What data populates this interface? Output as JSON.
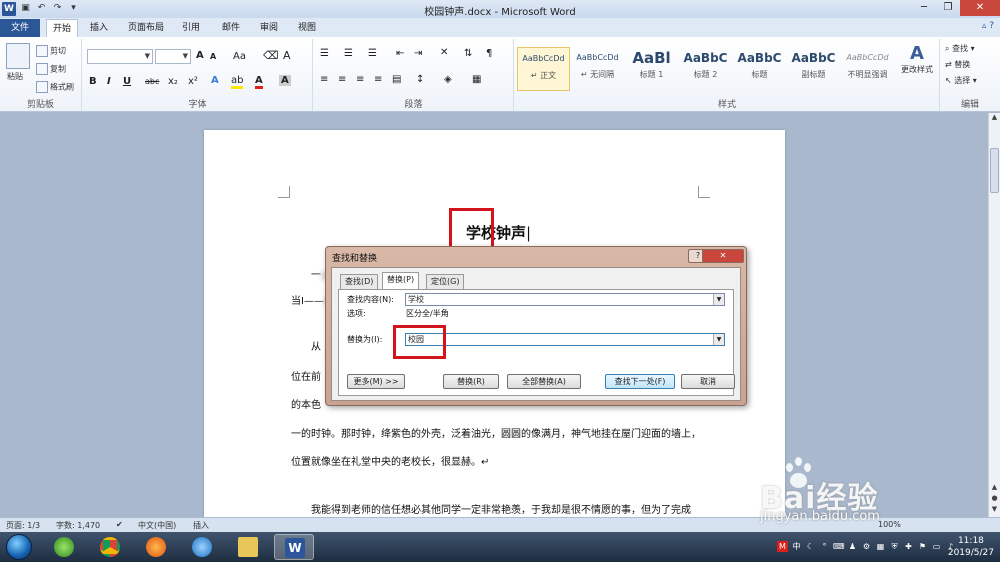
{
  "window": {
    "title": "校园钟声.docx - Microsoft Word",
    "app_icon": "W",
    "min": "─",
    "max": "❐",
    "close": "✕"
  },
  "tabs": {
    "file": "文件",
    "items": [
      "开始",
      "插入",
      "页面布局",
      "引用",
      "邮件",
      "审阅",
      "视图"
    ],
    "active": "开始"
  },
  "ribbon": {
    "clipboard": {
      "label": "剪贴板",
      "paste": "粘贴",
      "cut": "剪切",
      "copy": "复制",
      "format_painter": "格式刷"
    },
    "font": {
      "label": "字体",
      "bold": "B",
      "italic": "I",
      "underline": "U",
      "strike": "abc",
      "sub": "x₂",
      "sup": "x²",
      "grow": "A",
      "shrink": "A",
      "case": "Aa"
    },
    "paragraph": {
      "label": "段落"
    },
    "styles": {
      "label": "样式",
      "items": [
        {
          "preview": "AaBbCcDd",
          "name": "↵ 正文"
        },
        {
          "preview": "AaBbCcDd",
          "name": "↵ 无间隔"
        },
        {
          "preview": "AaBl",
          "name": "标题 1"
        },
        {
          "preview": "AaBbC",
          "name": "标题 2"
        },
        {
          "preview": "AaBbC",
          "name": "标题"
        },
        {
          "preview": "AaBbC",
          "name": "副标题"
        },
        {
          "preview": "AaBbCcDd",
          "name": "不明显强调"
        }
      ],
      "change": "更改样式"
    },
    "editing": {
      "label": "编辑",
      "find": "查找 ▾",
      "replace": "替换",
      "select": "选择 ▾"
    }
  },
  "document": {
    "title_part1": "学校",
    "title_part2": "钟声",
    "lines": [
      "一",
      "当I——",
      "从",
      "位在前",
      "的本色",
      "一的时钟。那时钟，绛紫色的外壳，泛着油光，圆圆的像满月，神气地挂在屋门迎面的墙上，",
      "位置就像坐在礼堂中央的老校长，很显赫。↵",
      "我能得到老师的信任想必其他同学一定非常艳羡，于我却是很不情愿的事，但为了完成"
    ]
  },
  "dialog": {
    "title": "查找和替换",
    "help": "?",
    "close": "✕",
    "tabs": [
      "查找(D)",
      "替换(P)",
      "定位(G)"
    ],
    "active_tab": "替换(P)",
    "find_label": "查找内容(N):",
    "find_value": "学校",
    "options_label": "选项:",
    "options_value": "区分全/半角",
    "replace_label": "替换为(I):",
    "replace_value": "校园",
    "more": "更多(M) >>",
    "replace_btn": "替换(R)",
    "replace_all_btn": "全部替换(A)",
    "find_next_btn": "查找下一处(F)",
    "cancel_btn": "取消"
  },
  "status": {
    "page": "页面: 1/3",
    "words": "字数: 1,470",
    "lang": "中文(中国)",
    "mode": "插入",
    "zoom": "100%"
  },
  "taskbar": {
    "time": "11:18",
    "date": "2019/5/27",
    "tray_ime": "中"
  },
  "watermark": {
    "brand": "Bai经验",
    "url": "jingyan.baidu.com"
  },
  "colors": {
    "highlight_box": "#d3141c",
    "file_tab": "#2b5797",
    "dialog_frame": "#c9a292"
  }
}
